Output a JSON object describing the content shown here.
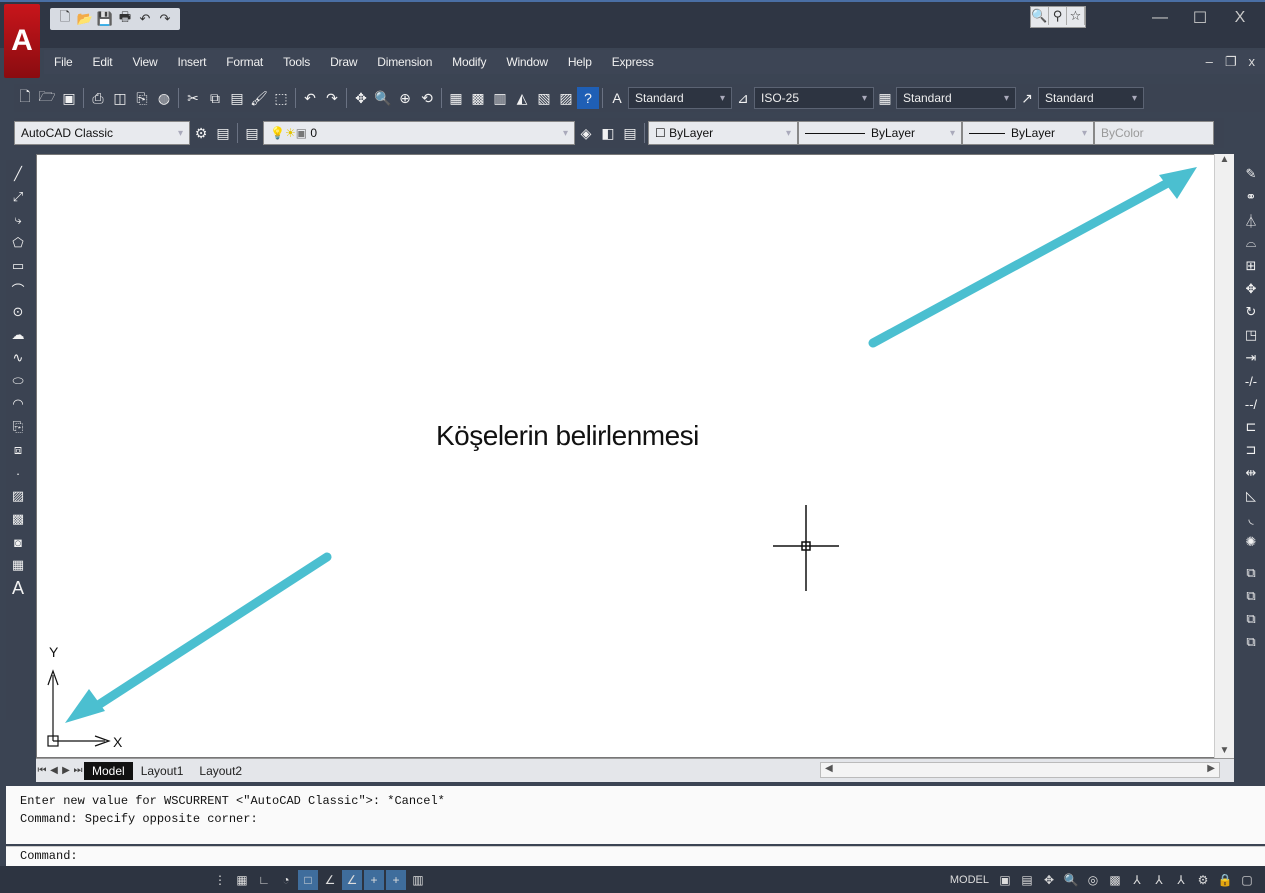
{
  "app": {
    "logo_letter": "A",
    "quick_access": [
      "new-icon",
      "open-icon",
      "save-icon",
      "print-icon",
      "undo-icon",
      "redo-icon"
    ],
    "window_controls": {
      "minimize": "—",
      "maximize": "☐",
      "close": "X"
    }
  },
  "menu": [
    "File",
    "Edit",
    "View",
    "Insert",
    "Format",
    "Tools",
    "Draw",
    "Dimension",
    "Modify",
    "Window",
    "Help",
    "Express"
  ],
  "mdi_controls": {
    "minimize": "–",
    "restore": "❐",
    "close": "x"
  },
  "styles": {
    "text_style": "Standard",
    "dim_style": "ISO-25",
    "table_style": "Standard",
    "multileader_style": "Standard"
  },
  "layers_toolbar": {
    "workspace": "AutoCAD Classic",
    "layer": "0",
    "color": "ByLayer",
    "linetype": "ByLayer",
    "lineweight": "ByLayer",
    "plotstyle": "ByColor"
  },
  "canvas": {
    "caption": "Köşelerin belirlenmesi",
    "ucs_x": "X",
    "ucs_y": "Y",
    "arrow_color": "#4bbfd0"
  },
  "tabs": {
    "model": "Model",
    "layout1": "Layout1",
    "layout2": "Layout2"
  },
  "command": {
    "history": [
      "Enter new value for WSCURRENT <\"AutoCAD Classic\">: *Cancel*",
      "Command: Specify opposite corner:"
    ],
    "prompt": "Command:"
  },
  "status": {
    "model_label": "MODEL"
  }
}
